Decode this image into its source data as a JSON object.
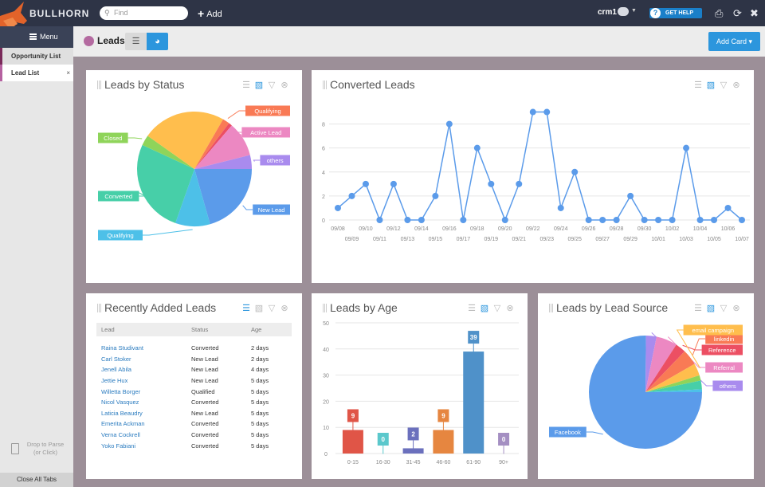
{
  "topbar": {
    "brand": "BULLHORN",
    "search_placeholder": "Find",
    "add_label": "Add",
    "user": "crm1",
    "help_label": "GET HELP"
  },
  "sidebar": {
    "menu_label": "Menu",
    "tabs": [
      {
        "label": "Opportunity List"
      },
      {
        "label": "Lead List",
        "close": "×"
      }
    ],
    "drop_label_1": "Drop to Parse",
    "drop_label_2": "(or Click)",
    "close_all": "Close All Tabs"
  },
  "header": {
    "title": "Leads",
    "add_card": "Add Card"
  },
  "colors": {
    "accent": "#2c96dd",
    "leads_dot": "#b46aa0",
    "line": "#5b9bea"
  },
  "cards": {
    "status_title": "Leads by Status",
    "converted_title": "Converted Leads",
    "recent_title": "Recently Added Leads",
    "age_title": "Leads by Age",
    "source_title": "Leads by Lead Source"
  },
  "recent": {
    "headers": [
      "Lead",
      "Status",
      "Age"
    ],
    "rows": [
      [
        "Raina Studivant",
        "Converted",
        "2 days"
      ],
      [
        "Carl Stoker",
        "New Lead",
        "2 days"
      ],
      [
        "Jenell Abila",
        "New Lead",
        "4 days"
      ],
      [
        "Jettie Hux",
        "New Lead",
        "5 days"
      ],
      [
        "Willetta Borger",
        "Qualified",
        "5 days"
      ],
      [
        "Nicol Vasquez",
        "Converted",
        "5 days"
      ],
      [
        "Laticia Beaudry",
        "New Lead",
        "5 days"
      ],
      [
        "Emerita Ackman",
        "Converted",
        "5 days"
      ],
      [
        "Verna Cockrell",
        "Converted",
        "5 days"
      ],
      [
        "Yoko Fabiani",
        "Converted",
        "5 days"
      ]
    ]
  },
  "chart_data": [
    {
      "type": "pie",
      "title": "Leads by Status",
      "slices": [
        {
          "label": "New Lead",
          "value": 21,
          "color": "#5b9bea"
        },
        {
          "label": "Qualifying",
          "value": 10,
          "color": "#4dc0e8"
        },
        {
          "label": "Converted",
          "value": 27,
          "color": "#47cfa8"
        },
        {
          "label": "Closed",
          "value": 3,
          "color": "#8fd45a"
        },
        {
          "label": "",
          "value": 24,
          "color": "#ffbe4d"
        },
        {
          "label": "Qualifying",
          "value": 2,
          "color": "#f97a55"
        },
        {
          "label": "",
          "value": 1,
          "color": "#ec4f63"
        },
        {
          "label": "Active Lead",
          "value": 10,
          "color": "#ec88c2"
        },
        {
          "label": "others",
          "value": 4,
          "color": "#a98bee"
        }
      ]
    },
    {
      "type": "line",
      "title": "Converted Leads",
      "x": [
        "09/08",
        "09/09",
        "09/10",
        "09/11",
        "09/12",
        "09/13",
        "09/14",
        "09/15",
        "09/16",
        "09/17",
        "09/18",
        "09/19",
        "09/20",
        "09/21",
        "09/22",
        "09/23",
        "09/24",
        "09/25",
        "09/26",
        "09/27",
        "09/28",
        "09/29",
        "09/30",
        "10/01",
        "10/02",
        "10/03",
        "10/04",
        "10/05",
        "10/06",
        "10/07"
      ],
      "values": [
        1,
        2,
        3,
        0,
        3,
        0,
        0,
        2,
        8,
        0,
        6,
        3,
        0,
        3,
        9,
        9,
        1,
        4,
        0,
        0,
        0,
        2,
        0,
        0,
        0,
        6,
        0,
        0,
        1,
        0
      ],
      "yticks": [
        0,
        2,
        4,
        6,
        8
      ],
      "ylim": [
        0,
        9.5
      ],
      "grid": true
    },
    {
      "type": "bar",
      "title": "Leads by Age",
      "categories": [
        "0-15",
        "16-30",
        "31-45",
        "46-60",
        "61-90",
        "90+"
      ],
      "values": [
        9,
        0,
        2,
        9,
        39,
        0
      ],
      "colors": [
        "#e05547",
        "#5bc8cc",
        "#6b70bd",
        "#e68640",
        "#4f91c9",
        "#a48fc2"
      ],
      "yticks": [
        0,
        10,
        20,
        30,
        40,
        50
      ],
      "ylim": [
        0,
        50
      ],
      "grid": true
    },
    {
      "type": "pie",
      "title": "Leads by Lead Source",
      "slices": [
        {
          "label": "Facebook",
          "value": 75,
          "color": "#5b9bea"
        },
        {
          "label": "others",
          "value": 3,
          "color": "#a98bee"
        },
        {
          "label": "Referral",
          "value": 6,
          "color": "#ec88c2"
        },
        {
          "label": "Reference",
          "value": 3,
          "color": "#ec4f63"
        },
        {
          "label": "linkedin",
          "value": 4.5,
          "color": "#f97a55"
        },
        {
          "label": "email campaign",
          "value": 3.5,
          "color": "#ffbe4d"
        },
        {
          "label": "",
          "value": 1.5,
          "color": "#8fd45a"
        },
        {
          "label": "",
          "value": 2.5,
          "color": "#47cfa8"
        },
        {
          "label": "",
          "value": 0.8,
          "color": "#4dc0e8"
        }
      ]
    }
  ]
}
